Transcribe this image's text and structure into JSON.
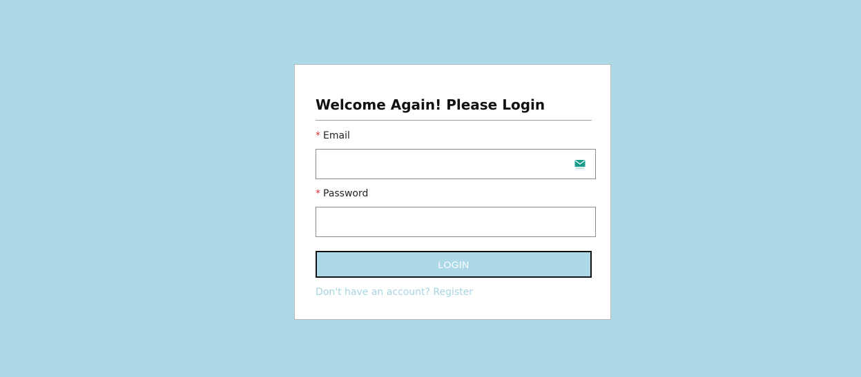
{
  "login_form": {
    "title": "Welcome Again! Please Login",
    "email": {
      "required_marker": "*",
      "label": "Email",
      "value": "",
      "icon": "mail-icon"
    },
    "password": {
      "required_marker": "*",
      "label": "Password",
      "value": ""
    },
    "submit_label": "LOGIN",
    "register_link_text": "Don't have an account? Register"
  },
  "colors": {
    "page_background": "#add8e6",
    "button_background": "#add8e6",
    "required_marker": "#e0333a",
    "link": "#a8d3e2",
    "mail_icon": "#1a9c8c"
  }
}
